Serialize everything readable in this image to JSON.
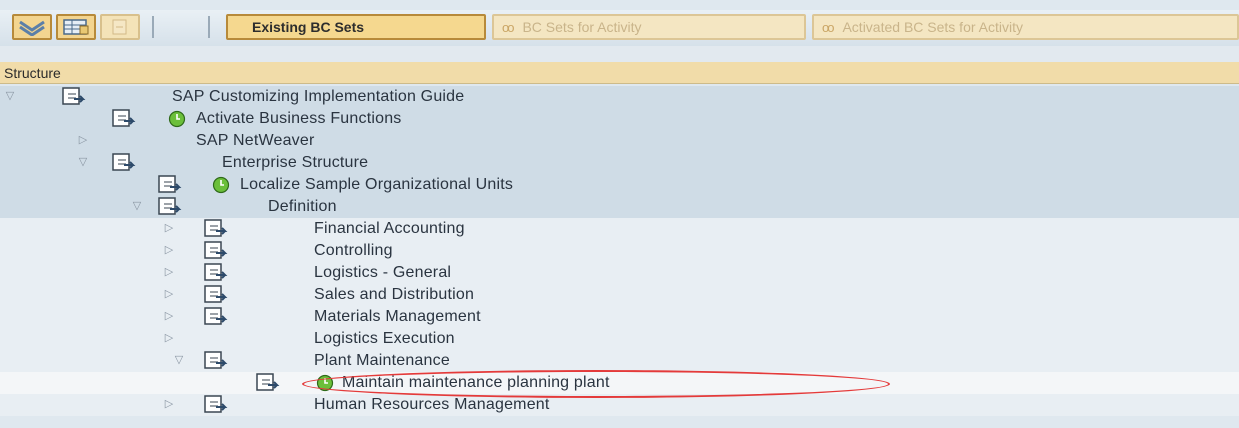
{
  "toolbar": {
    "existing_bc_sets": "Existing BC Sets",
    "bc_sets_for_activity": "BC Sets for Activity",
    "activated_bc_sets_for_activity": "Activated BC Sets for Activity"
  },
  "header": {
    "title": "Structure"
  },
  "tree": {
    "rows": [
      {
        "label": "SAP Customizing Implementation Guide"
      },
      {
        "label": "Activate Business Functions"
      },
      {
        "label": "SAP NetWeaver"
      },
      {
        "label": "Enterprise Structure"
      },
      {
        "label": "Localize Sample Organizational Units"
      },
      {
        "label": "Definition"
      },
      {
        "label": "Financial Accounting"
      },
      {
        "label": "Controlling"
      },
      {
        "label": "Logistics - General"
      },
      {
        "label": "Sales and Distribution"
      },
      {
        "label": "Materials Management"
      },
      {
        "label": "Logistics Execution"
      },
      {
        "label": "Plant Maintenance"
      },
      {
        "label": "Maintain maintenance planning plant"
      },
      {
        "label": "Human Resources Management"
      }
    ]
  },
  "colors": {
    "row_blue": "#cfdce6",
    "row_light": "#e8eef3",
    "row_lightest": "#f4f6f8",
    "header_bg": "#f1dca9",
    "highlight_ellipse": "#e43a3a"
  }
}
